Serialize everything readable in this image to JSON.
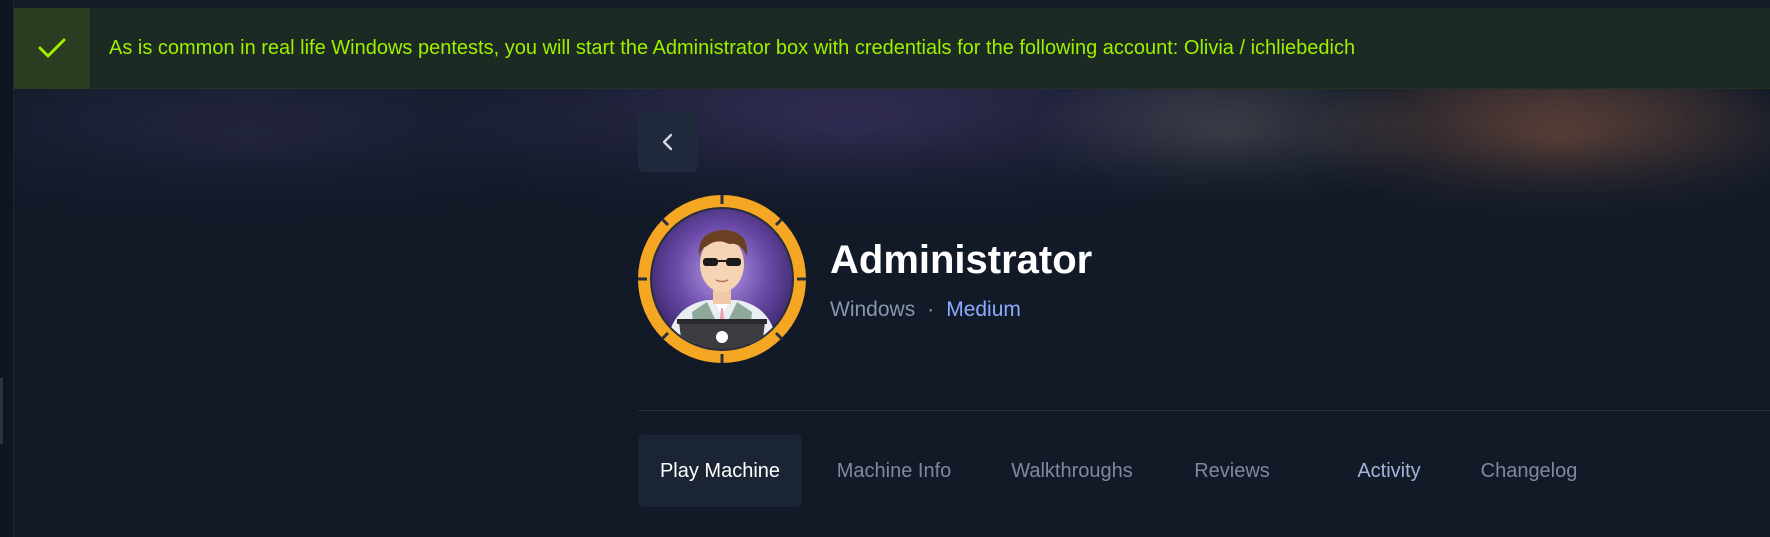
{
  "notification": {
    "message": "As is common in real life Windows pentests, you will start the Administrator box with credentials for the following account: Olivia / ichliebedich",
    "icon": "check-icon",
    "color": "#9fef00"
  },
  "back_button": {
    "icon": "chevron-left-icon"
  },
  "machine": {
    "name": "Administrator",
    "os": "Windows",
    "separator": "·",
    "difficulty": "Medium",
    "difficulty_color": "#8aabff",
    "avatar_ring_color": "#f5a623"
  },
  "tabs": [
    {
      "label": "Play Machine",
      "active": true
    },
    {
      "label": "Machine Info"
    },
    {
      "label": "Walkthroughs"
    },
    {
      "label": "Reviews"
    },
    {
      "label": "Activity"
    },
    {
      "label": "Changelog"
    }
  ]
}
